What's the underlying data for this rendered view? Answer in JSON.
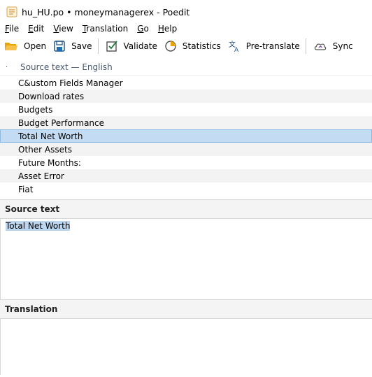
{
  "window": {
    "title": "hu_HU.po • moneymanagerex - Poedit"
  },
  "menu": [
    {
      "accel": "F",
      "rest": "ile"
    },
    {
      "accel": "E",
      "rest": "dit"
    },
    {
      "accel": "V",
      "rest": "iew"
    },
    {
      "accel": "T",
      "rest": "ranslation"
    },
    {
      "accel": "G",
      "rest": "o"
    },
    {
      "accel": "H",
      "rest": "elp"
    }
  ],
  "toolbar": {
    "open": "Open",
    "save": "Save",
    "validate": "Validate",
    "statistics": "Statistics",
    "pretranslate": "Pre-translate",
    "sync": "Sync"
  },
  "list": {
    "header_marker": "·",
    "column_title": "Source text — English",
    "rows": [
      "C&ustom Fields Manager",
      "Download rates",
      "Budgets",
      "Budget Performance",
      "Total Net Worth",
      "Other Assets",
      "Future Months:",
      "Asset Error",
      "Fiat"
    ],
    "selected_index": 4
  },
  "editor": {
    "source_label": "Source text",
    "source_value": "Total Net Worth",
    "translation_label": "Translation",
    "translation_value": ""
  },
  "colors": {
    "selection": "#c4dcf3",
    "row_alt": "#f3f3f3",
    "folder": "#e8a400",
    "accent": "#1a6fb5"
  }
}
